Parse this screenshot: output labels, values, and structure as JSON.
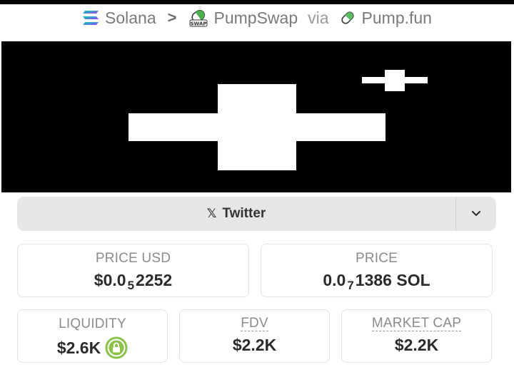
{
  "breadcrumb": {
    "chain": "Solana",
    "dex": "PumpSwap",
    "dex_badge": "SWAP",
    "via": "via",
    "launchpad": "Pump.fun"
  },
  "social": {
    "twitter_label": "Twitter"
  },
  "stats": {
    "price_usd": {
      "label": "PRICE USD",
      "prefix": "$0.0",
      "zeros": "5",
      "digits": "2252"
    },
    "price": {
      "label": "PRICE",
      "prefix": "0.0",
      "zeros": "7",
      "digits": "1386 SOL"
    },
    "liquidity": {
      "label": "LIQUIDITY",
      "value": "$2.6K"
    },
    "fdv": {
      "label": "FDV",
      "value": "$2.2K"
    },
    "market_cap": {
      "label": "MARKET CAP",
      "value": "$2.2K"
    }
  },
  "colors": {
    "lock_green": "#8bc34a",
    "banner_bg": "#000000"
  },
  "icons": [
    "solana-icon",
    "chevron-right-icon",
    "pumpswap-icon",
    "pill-icon",
    "x-icon",
    "chevron-down-icon",
    "lock-icon"
  ]
}
